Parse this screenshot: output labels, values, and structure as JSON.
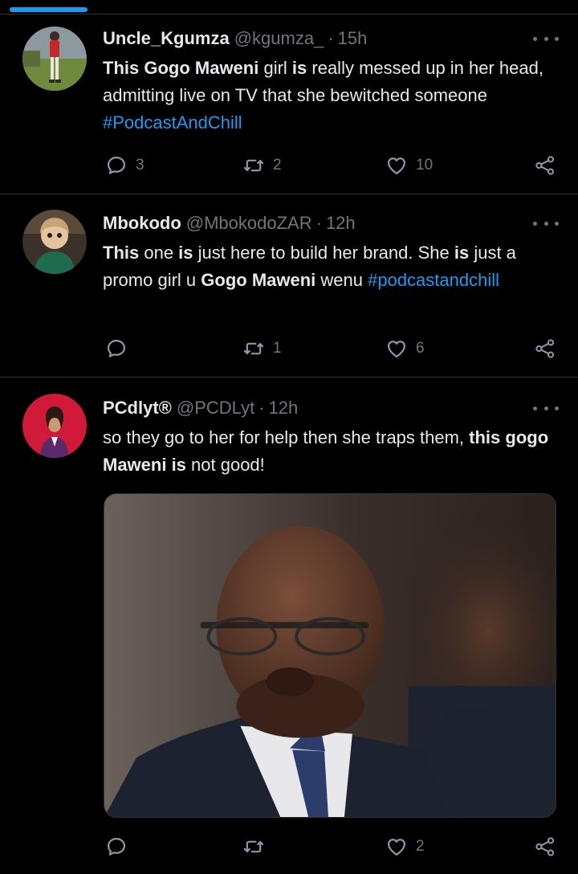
{
  "tweets": [
    {
      "name": "Uncle_Kgumza",
      "handle": "@kgumza_",
      "separator": "·",
      "time": "15h",
      "text": [
        {
          "t": "This Gogo Maweni",
          "style": "bold"
        },
        {
          "t": " girl ",
          "style": "normal"
        },
        {
          "t": "is",
          "style": "bold"
        },
        {
          "t": " really messed up in her head, admitting live on TV that she bewitched someone ",
          "style": "normal"
        },
        {
          "t": "#PodcastAndChill",
          "style": "hashtag"
        }
      ],
      "reply_count": "3",
      "retweet_count": "2",
      "like_count": "10"
    },
    {
      "name": "Mbokodo",
      "handle": "@MbokodoZAR",
      "separator": "·",
      "time": "12h",
      "text": [
        {
          "t": "This",
          "style": "bold"
        },
        {
          "t": " one ",
          "style": "normal"
        },
        {
          "t": "is",
          "style": "bold"
        },
        {
          "t": " just here to build her brand. She ",
          "style": "normal"
        },
        {
          "t": "is",
          "style": "bold"
        },
        {
          "t": " just a promo girl u ",
          "style": "normal"
        },
        {
          "t": "Gogo Maweni",
          "style": "bold"
        },
        {
          "t": " wenu ",
          "style": "normal"
        },
        {
          "t": "#podcastandchill",
          "style": "hashtag"
        }
      ],
      "reply_count": "",
      "retweet_count": "1",
      "like_count": "6"
    },
    {
      "name": "PCdlyt®",
      "handle": "@PCDLyt",
      "separator": "·",
      "time": "12h",
      "text": [
        {
          "t": "so they go to  her for help then she traps them, ",
          "style": "normal"
        },
        {
          "t": "this gogo Maweni is",
          "style": "bold"
        },
        {
          "t": " not good!",
          "style": "normal"
        }
      ],
      "reply_count": "",
      "retweet_count": "",
      "like_count": "2"
    }
  ],
  "icons": {
    "reply": "reply-icon",
    "retweet": "retweet-icon",
    "like": "heart-icon",
    "share": "share-icon",
    "more": "more-icon"
  },
  "colors": {
    "background": "#000000",
    "text": "#e7e9ea",
    "muted": "#71767b",
    "accent": "#1d9bf0",
    "divider": "#2f3336"
  }
}
